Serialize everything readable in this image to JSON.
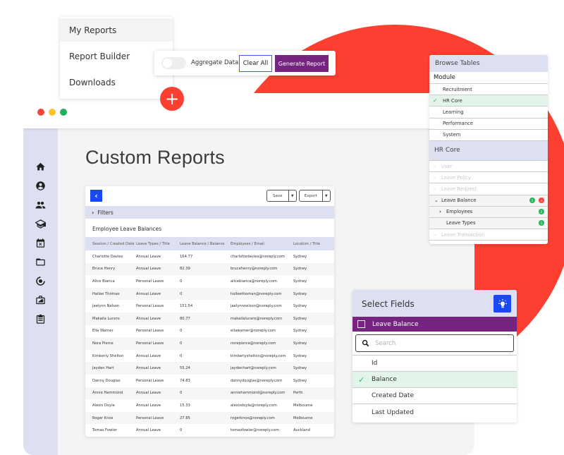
{
  "nav_menu": {
    "items": [
      {
        "label": "My Reports",
        "active": true
      },
      {
        "label": "Report Builder",
        "active": false
      },
      {
        "label": "Downloads",
        "active": false
      }
    ],
    "add_button_icon": "plus-icon"
  },
  "toolbar": {
    "aggregate_label": "Aggregate Data",
    "aggregate_enabled": false,
    "clear_label": "Clear All",
    "generate_label": "Generate Report"
  },
  "window": {
    "title": "Custom Reports",
    "sidebar_icons": [
      "home-icon",
      "user-icon",
      "people-icon",
      "graduation-cap-icon",
      "calendar-icon",
      "folder-icon",
      "payroll-icon",
      "briefcase-icon",
      "clipboard-icon"
    ]
  },
  "report": {
    "back_icon": "chevron-left-icon",
    "save_label": "Save",
    "export_label": "Export",
    "filters_label": "Filters",
    "table_title": "Employee Leave Balances",
    "columns": [
      "Session / Created Date",
      "Leave Types / Title",
      "Leave Balance / Balance",
      "Employees / Email",
      "Location / Title"
    ],
    "rows": [
      [
        "Charlotte Davies",
        "Annual Leave",
        "164.77",
        "charlottedavies@noreply.com",
        "Sydney"
      ],
      [
        "Bruce Henry",
        "Annual Leave",
        "82.39",
        "brucehenry@noreply.com",
        "Sydney"
      ],
      [
        "Alice Bianca",
        "Personal Leave",
        "0",
        "alicebianca@noreply.com",
        "Sydney"
      ],
      [
        "Hallee Thomas",
        "Annual Leave",
        "0",
        "halleethoman@noreply.com",
        "Sydney"
      ],
      [
        "Jaelynn Nelson",
        "Personal Leave",
        "151.54",
        "jaelynnnelson@noreply.com",
        "Sydney"
      ],
      [
        "Makaila Lucero",
        "Annual Leave",
        "80.77",
        "makailalucero@noreply.com",
        "Sydney"
      ],
      [
        "Ella Warner",
        "Personal Leave",
        "0",
        "ellawarner@noreply.com",
        "Sydney"
      ],
      [
        "Nora Pierce",
        "Personal Leave",
        "0",
        "norepierce@noreply.com",
        "Sydney"
      ],
      [
        "Kimberly Shelton",
        "Annual Leave",
        "0",
        "kimberlyshelton@noreply.com",
        "Sydney"
      ],
      [
        "Jayden Hart",
        "Annual Leave",
        "55.24",
        "jaydenhart@noreply.com",
        "Sydney"
      ],
      [
        "Danny Douglas",
        "Personal Leave",
        "74.83",
        "dannydouglas@noreply.com",
        "Sydney"
      ],
      [
        "Annie Hammond",
        "Annual Leave",
        "0",
        "anniehammond@noreply.com",
        "Perth"
      ],
      [
        "Alexis Doyle",
        "Annual Leave",
        "15.33",
        "alexisdoyle@noreply.com",
        "Melbourne"
      ],
      [
        "Roger Knox",
        "Personal Leave",
        "27.85",
        "rogerknox@noreply.com",
        "Melbourne"
      ],
      [
        "Tomas Fowler",
        "Annual Leave",
        "0",
        "tomasfowler@noreply.com",
        "Auckland"
      ]
    ]
  },
  "browse_tables": {
    "title": "Browse Tables",
    "module_label": "Module",
    "modules": [
      {
        "label": "Recruitment",
        "selected": false
      },
      {
        "label": "HR Core",
        "selected": true
      },
      {
        "label": "Learning",
        "selected": false
      },
      {
        "label": "Performance",
        "selected": false
      },
      {
        "label": "System",
        "selected": false
      }
    ],
    "section_title": "HR Core",
    "tables": [
      {
        "label": "User",
        "state": "disabled"
      },
      {
        "label": "Leave Policy",
        "state": "disabled"
      },
      {
        "label": "Leave Request",
        "state": "disabled"
      },
      {
        "label": "Leave Balance",
        "state": "expanded",
        "badge": "1",
        "removable": true
      },
      {
        "label": "Employees",
        "state": "child-collapsed",
        "badge": "2"
      },
      {
        "label": "Leave Types",
        "state": "child",
        "badge": "1"
      },
      {
        "label": "Leave Transaction",
        "state": "disabled"
      }
    ]
  },
  "select_fields": {
    "title": "Select Fields",
    "hint_icon": "lightbulb-icon",
    "group_label": "Leave Balance",
    "search_placeholder": "Search",
    "fields": [
      {
        "label": "Id",
        "selected": false
      },
      {
        "label": "Balance",
        "selected": true
      },
      {
        "label": "Created Date",
        "selected": false
      },
      {
        "label": "Last Updated",
        "selected": false
      }
    ]
  },
  "colors": {
    "accent_red": "#fd3f31",
    "brand_purple": "#75247f",
    "primary_blue": "#1a48f5",
    "success_green": "#2db35f",
    "panel_lavender": "#dde0f0"
  }
}
